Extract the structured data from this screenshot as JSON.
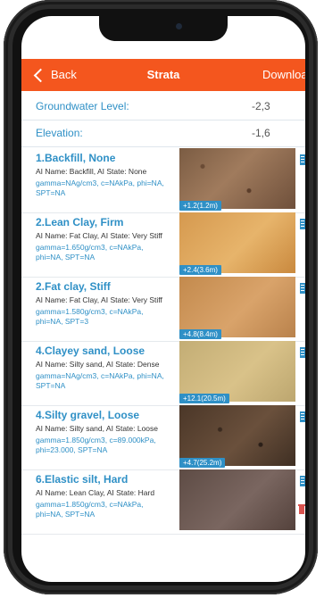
{
  "nav": {
    "back_label": "Back",
    "title": "Strata",
    "right_label": "Download"
  },
  "groundwater": {
    "label": "Groundwater Level:",
    "value": "-2,3"
  },
  "elevation": {
    "label": "Elevation:",
    "value": "-1,6"
  },
  "strata": [
    {
      "name": "1.Backfill, None",
      "ai": "AI Name: Backfill, AI State: None",
      "params": "gamma=NAg/cm3, c=NAkPa, phi=NA, SPT=NA",
      "depth": "+1.2(1.2m)"
    },
    {
      "name": "2.Lean Clay, Firm",
      "ai": "AI Name: Fat Clay, AI State: Very Stiff",
      "params": "gamma=1.650g/cm3, c=NAkPa, phi=NA, SPT=NA",
      "depth": "+2.4(3.6m)"
    },
    {
      "name": "2.Fat clay, Stiff",
      "ai": "AI Name: Fat Clay, AI State: Very Stiff",
      "params": "gamma=1.580g/cm3, c=NAkPa, phi=NA, SPT=3",
      "depth": "+4.8(8.4m)"
    },
    {
      "name": "4.Clayey sand, Loose",
      "ai": "AI Name: Silty sand, AI State: Dense",
      "params": "gamma=NAg/cm3, c=NAkPa, phi=NA, SPT=NA",
      "depth": "+12.1(20.5m)"
    },
    {
      "name": "4.Silty gravel, Loose",
      "ai": "AI Name: Silty sand, AI State: Loose",
      "params": "gamma=1.850g/cm3, c=89.000kPa, phi=23.000, SPT=NA",
      "depth": "+4.7(25.2m)"
    },
    {
      "name": "6.Elastic silt, Hard",
      "ai": "AI Name: Lean Clay, AI State: Hard",
      "params": "gamma=1.850g/cm3, c=NAkPa, phi=NA, SPT=NA",
      "depth": ""
    }
  ],
  "colors": {
    "accent": "#f4561e",
    "link": "#2f90c6",
    "edit_icon": "#2f90c6",
    "delete_icon": "#d9534f"
  },
  "icons": {
    "back": "chevron-left-icon",
    "edit": "edit-icon",
    "delete": "trash-icon"
  }
}
